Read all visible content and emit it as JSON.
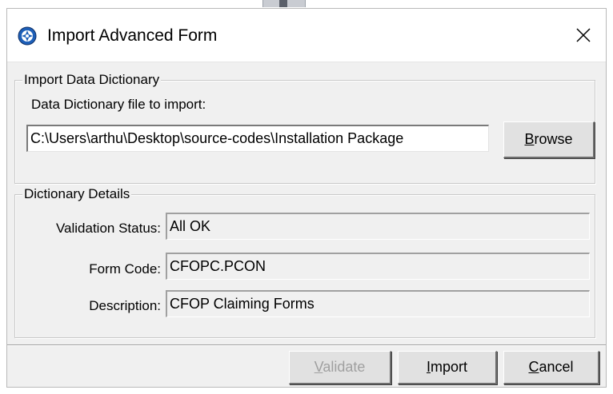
{
  "window": {
    "title": "Import Advanced Form"
  },
  "import_group": {
    "legend": "Import Data Dictionary",
    "file_label": "Data Dictionary file to import:",
    "file_path": "C:\\Users\\arthu\\Desktop\\source-codes\\Installation Package",
    "browse_label": "Browse",
    "browse_accel": "B",
    "browse_rest": "rowse"
  },
  "details_group": {
    "legend": "Dictionary Details",
    "validation_label": "Validation Status:",
    "validation_value": "All OK",
    "form_code_label": "Form Code:",
    "form_code_value": "CFOPC.PCON",
    "description_label": "Description:",
    "description_value": "CFOP Claiming Forms"
  },
  "footer": {
    "validate": {
      "accel": "V",
      "rest": "alidate"
    },
    "import": {
      "accel": "I",
      "rest": "mport"
    },
    "cancel": {
      "accel": "C",
      "rest": "ancel"
    }
  },
  "icons": {
    "app": "app-globe-icon",
    "close": "close-icon"
  },
  "colors": {
    "app_icon_blue": "#1d5fb8",
    "disabled_text": "#a0a0a0"
  }
}
